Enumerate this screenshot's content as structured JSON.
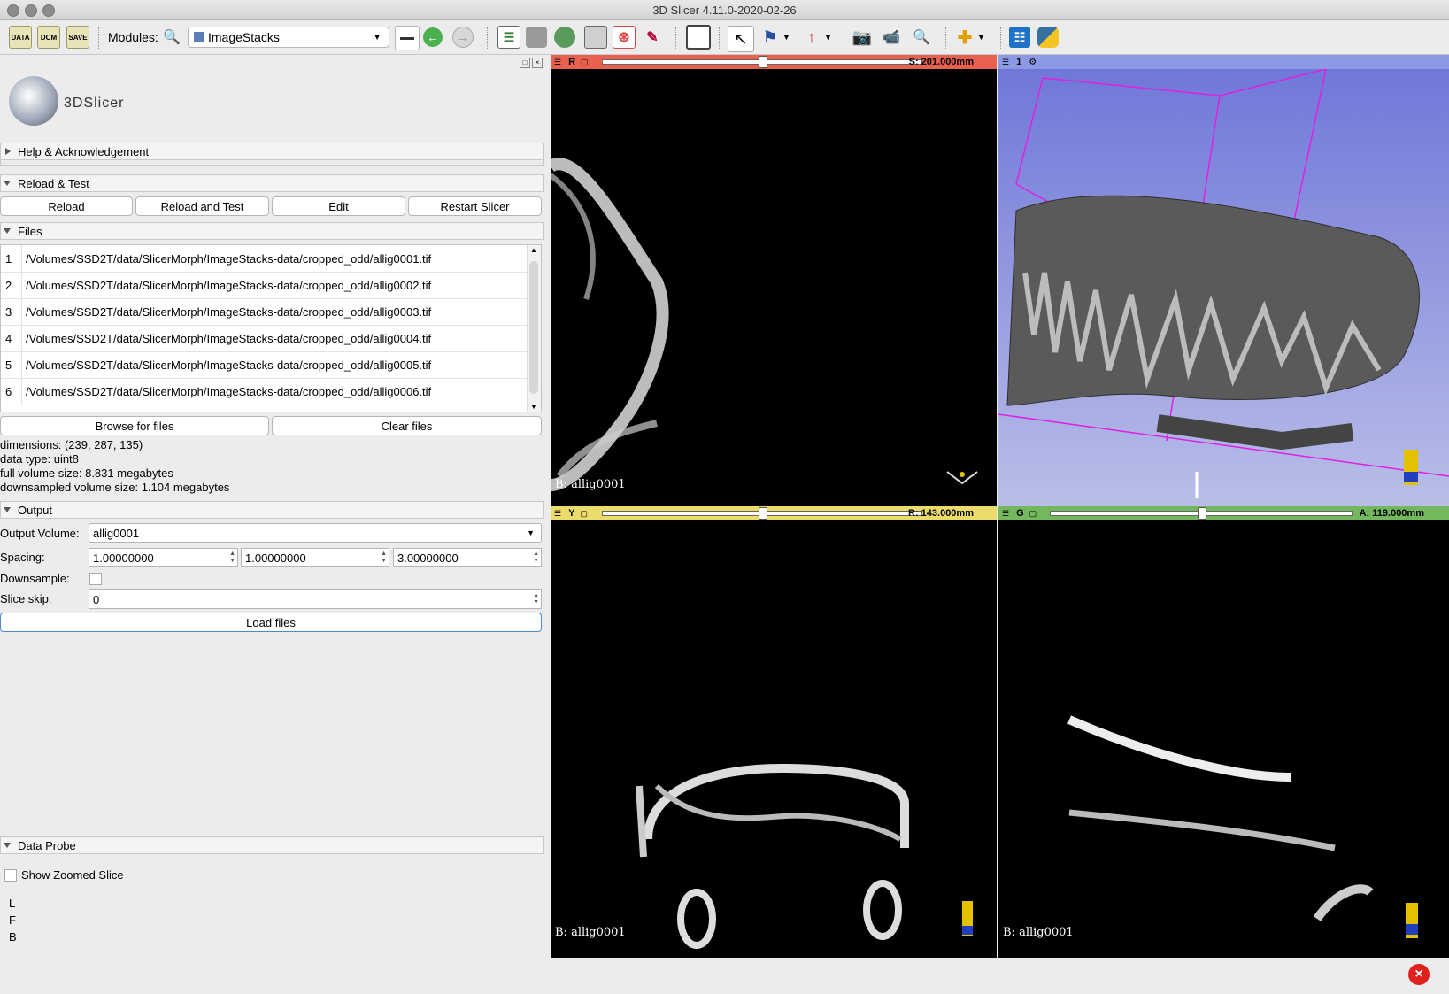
{
  "window": {
    "title": "3D Slicer 4.11.0-2020-02-26"
  },
  "toolbar": {
    "data_icon": "DATA",
    "dcm_icon": "DCM",
    "save_icon": "SAVE",
    "modules_label": "Modules:",
    "module_selected": "ImageStacks"
  },
  "logo": {
    "text": "3DSlicer"
  },
  "sections": {
    "help": "Help & Acknowledgement",
    "reload": "Reload & Test",
    "files": "Files",
    "output": "Output",
    "probe": "Data Probe"
  },
  "reload_buttons": {
    "reload": "Reload",
    "reload_test": "Reload and Test",
    "edit": "Edit",
    "restart": "Restart Slicer"
  },
  "files": [
    {
      "n": "1",
      "path": "/Volumes/SSD2T/data/SlicerMorph/ImageStacks-data/cropped_odd/allig0001.tif"
    },
    {
      "n": "2",
      "path": "/Volumes/SSD2T/data/SlicerMorph/ImageStacks-data/cropped_odd/allig0002.tif"
    },
    {
      "n": "3",
      "path": "/Volumes/SSD2T/data/SlicerMorph/ImageStacks-data/cropped_odd/allig0003.tif"
    },
    {
      "n": "4",
      "path": "/Volumes/SSD2T/data/SlicerMorph/ImageStacks-data/cropped_odd/allig0004.tif"
    },
    {
      "n": "5",
      "path": "/Volumes/SSD2T/data/SlicerMorph/ImageStacks-data/cropped_odd/allig0005.tif"
    },
    {
      "n": "6",
      "path": "/Volumes/SSD2T/data/SlicerMorph/ImageStacks-data/cropped_odd/allig0006.tif"
    }
  ],
  "file_buttons": {
    "browse": "Browse for files",
    "clear": "Clear files"
  },
  "info": {
    "dimensions": "dimensions: (239, 287, 135)",
    "datatype": "data type: uint8",
    "full_size": "full volume size: 8.831 megabytes",
    "down_size": "downsampled volume size: 1.104 megabytes"
  },
  "output": {
    "volume_label": "Output Volume:",
    "volume_value": "allig0001",
    "spacing_label": "Spacing:",
    "spacing": [
      "1.00000000",
      "1.00000000",
      "3.00000000"
    ],
    "downsample_label": "Downsample:",
    "downsample_checked": false,
    "skip_label": "Slice skip:",
    "skip_value": "0",
    "load": "Load files"
  },
  "probe": {
    "show_zoomed": "Show Zoomed Slice",
    "L": "L",
    "F": "F",
    "B": "B"
  },
  "views": {
    "red": {
      "letter": "R",
      "offset": "S: 201.000mm",
      "label": "B: allig0001",
      "color": "#e9604e",
      "slider": 0.5
    },
    "threed": {
      "letter": "1",
      "color": "#8c9ae6"
    },
    "yellow": {
      "letter": "Y",
      "offset": "R: 143.000mm",
      "label": "B: allig0001",
      "color": "#eadb6a",
      "slider": 0.5
    },
    "green": {
      "letter": "G",
      "offset": "A: 119.000mm",
      "label": "B: allig0001",
      "color": "#73b85c",
      "slider": 0.5
    }
  }
}
